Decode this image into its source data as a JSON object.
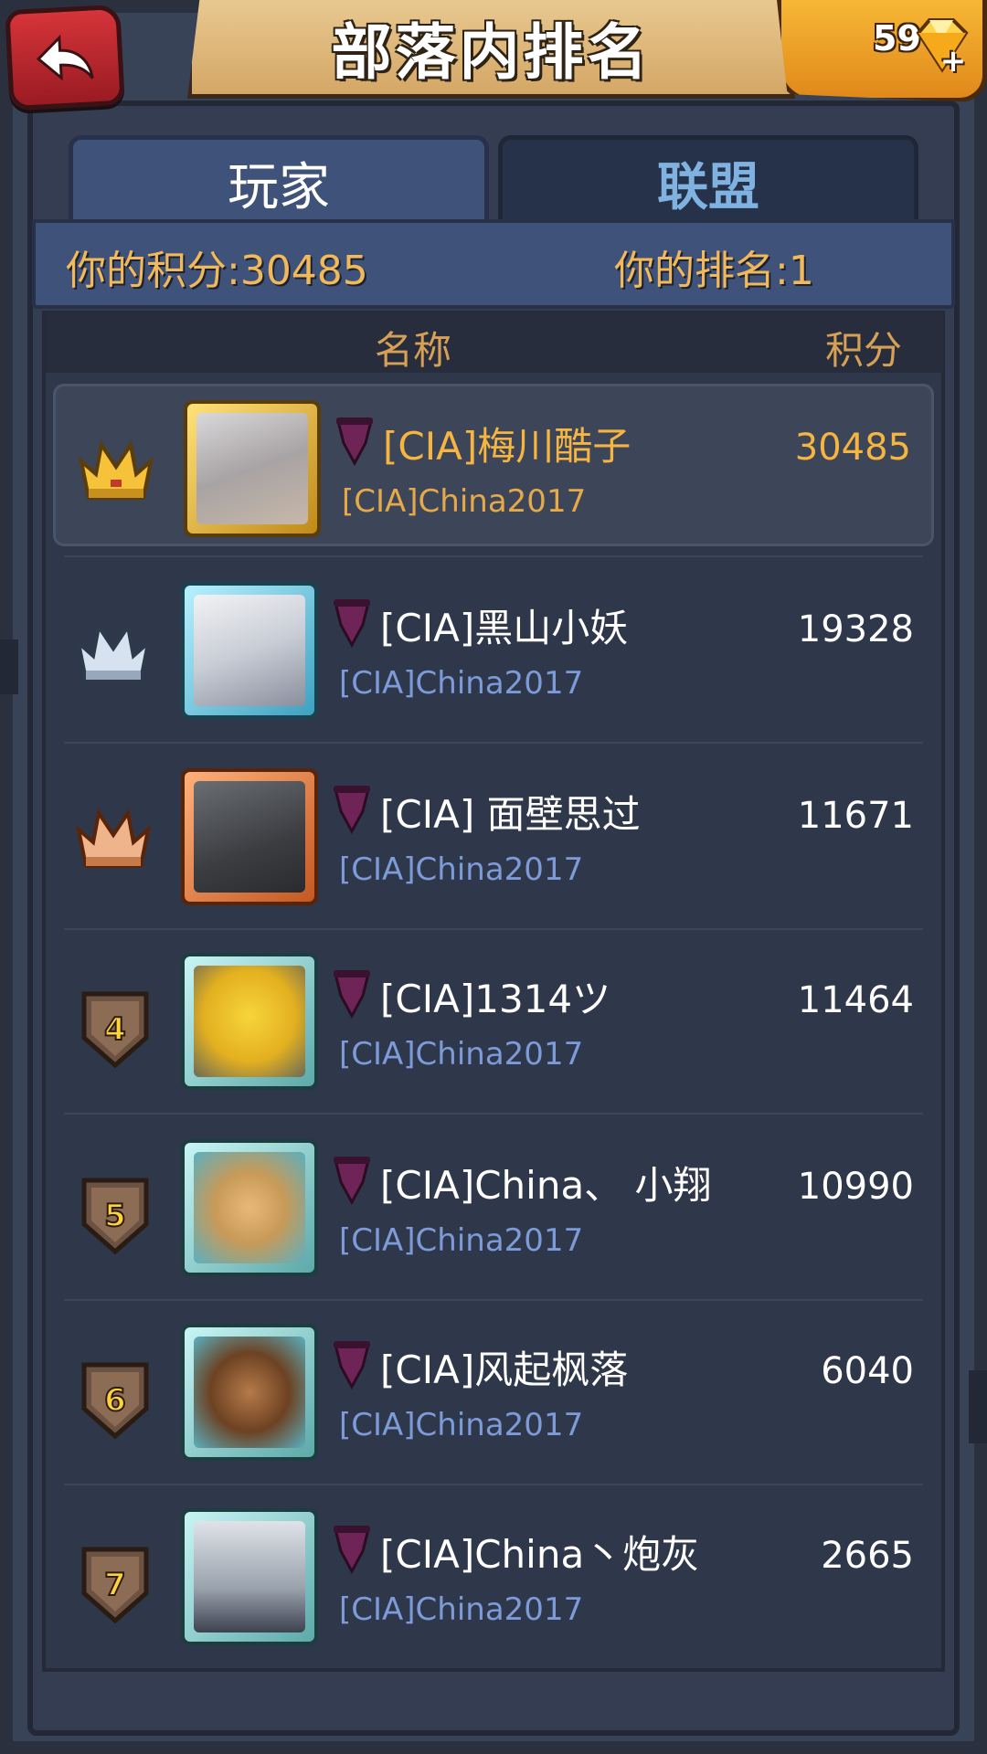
{
  "header": {
    "title": "部落内排名",
    "gems": "59",
    "back_icon": "back-arrow-icon",
    "gem_icon": "gem-icon"
  },
  "tabs": [
    {
      "label": "玩家",
      "active": true
    },
    {
      "label": "联盟",
      "active": false
    }
  ],
  "summary": {
    "my_score": "你的积分:30485",
    "my_rank": "你的排名:1"
  },
  "columns": {
    "name": "名称",
    "score": "积分"
  },
  "rows": [
    {
      "rank": "1",
      "name": "[CIA]梅川酷子",
      "tag": "[CIA]China2017",
      "score": "30485",
      "frame": "gold"
    },
    {
      "rank": "2",
      "name": "[CIA]黑山小妖",
      "tag": "[CIA]China2017",
      "score": "19328",
      "frame": "silver"
    },
    {
      "rank": "3",
      "name": "[CIA] 面壁思过 ",
      "tag": "[CIA]China2017",
      "score": "11671",
      "frame": "bronze"
    },
    {
      "rank": "4",
      "name": "[CIA]1314ツ",
      "tag": "[CIA]China2017",
      "score": "11464",
      "frame": "teal"
    },
    {
      "rank": "5",
      "name": "[CIA]China、 小翔",
      "tag": "[CIA]China2017",
      "score": "10990",
      "frame": "teal"
    },
    {
      "rank": "6",
      "name": "[CIA]风起枫落",
      "tag": "[CIA]China2017",
      "score": "6040",
      "frame": "teal"
    },
    {
      "rank": "7",
      "name": "[CIA]China丶炮灰",
      "tag": "[CIA]China2017",
      "score": "2665",
      "frame": "teal"
    }
  ],
  "colors": {
    "gold_text": "#f5b540",
    "tag_blue": "#7c9bd8",
    "header_text": "#d6a055",
    "tab_inactive_text": "#7fb2e0"
  }
}
